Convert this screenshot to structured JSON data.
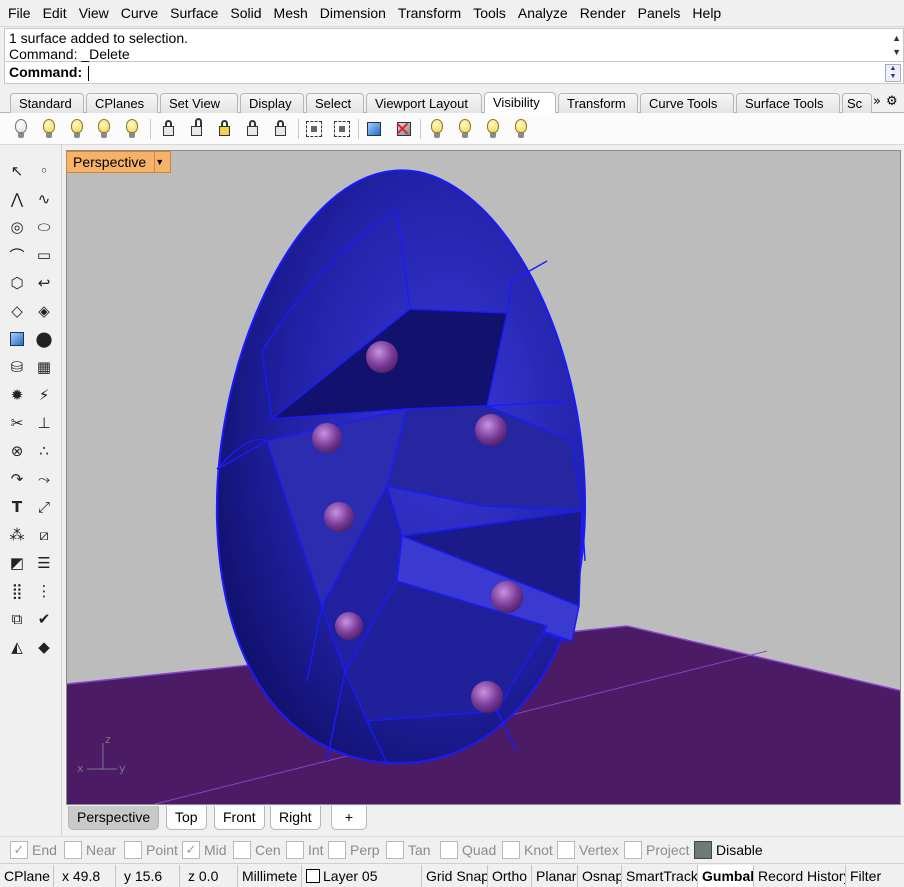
{
  "menu": [
    "File",
    "Edit",
    "View",
    "Curve",
    "Surface",
    "Solid",
    "Mesh",
    "Dimension",
    "Transform",
    "Tools",
    "Analyze",
    "Render",
    "Panels",
    "Help"
  ],
  "command": {
    "history": [
      "1 surface added to selection.",
      "Command: _Delete"
    ],
    "prompt_label": "Command:",
    "value": ""
  },
  "toolbar_tabs": [
    "Standard",
    "CPlanes",
    "Set View",
    "Display",
    "Select",
    "Viewport Layout",
    "Visibility",
    "Transform",
    "Curve Tools",
    "Surface Tools",
    "Sc"
  ],
  "active_toolbar_tab": "Visibility",
  "toolbar_icons": [
    "show-objects-icon",
    "hide-objects-icon",
    "show-selected-icon",
    "hide-swap-icon",
    "show-selected-lights-icon",
    "lock-icon",
    "unlock-icon",
    "unlock-selected-icon",
    "lock-swap-icon",
    "lock-icon-2",
    "show-points-icon",
    "hide-points-icon",
    "show-control-points-icon",
    "hide-control-points-icon",
    "lights-on-icon",
    "lights-off-icon",
    "light-bulb-icon",
    "light-bulb-icon-2"
  ],
  "viewport": {
    "title": "Perspective",
    "axis_labels": {
      "z": "z",
      "x": "x",
      "y": "y"
    },
    "colors": {
      "background": "#bcbcbc",
      "ground": "#4b1b66",
      "egg": "#2424a6",
      "edges": "#1010ff",
      "spheres": "#7a3b9a"
    }
  },
  "viewport_tabs": [
    "Perspective",
    "Top",
    "Front",
    "Right",
    "+"
  ],
  "active_viewport_tab": "Perspective",
  "osnaps": [
    {
      "label": "End",
      "checked": true,
      "enabled": false
    },
    {
      "label": "Near",
      "checked": false,
      "enabled": false
    },
    {
      "label": "Point",
      "checked": false,
      "enabled": false
    },
    {
      "label": "Mid",
      "checked": true,
      "enabled": false
    },
    {
      "label": "Cen",
      "checked": false,
      "enabled": false
    },
    {
      "label": "Int",
      "checked": false,
      "enabled": false
    },
    {
      "label": "Perp",
      "checked": false,
      "enabled": false
    },
    {
      "label": "Tan",
      "checked": false,
      "enabled": false
    },
    {
      "label": "Quad",
      "checked": false,
      "enabled": false
    },
    {
      "label": "Knot",
      "checked": false,
      "enabled": false
    },
    {
      "label": "Vertex",
      "checked": false,
      "enabled": false
    },
    {
      "label": "Project",
      "checked": false,
      "enabled": false
    },
    {
      "label": "Disable",
      "checked": true,
      "enabled": true
    }
  ],
  "status": {
    "cplane": "CPlane",
    "x": "x 49.8",
    "y": "y 15.6",
    "z": "z 0.0",
    "units": "Millimete",
    "layer": "Layer 05",
    "grid_snap": "Grid Snap",
    "ortho": "Ortho",
    "planar": "Planar",
    "osnap": "Osnap",
    "smarttrack": "SmartTrack",
    "gumball": "Gumball",
    "record_history": "Record History",
    "filter": "Filter"
  }
}
